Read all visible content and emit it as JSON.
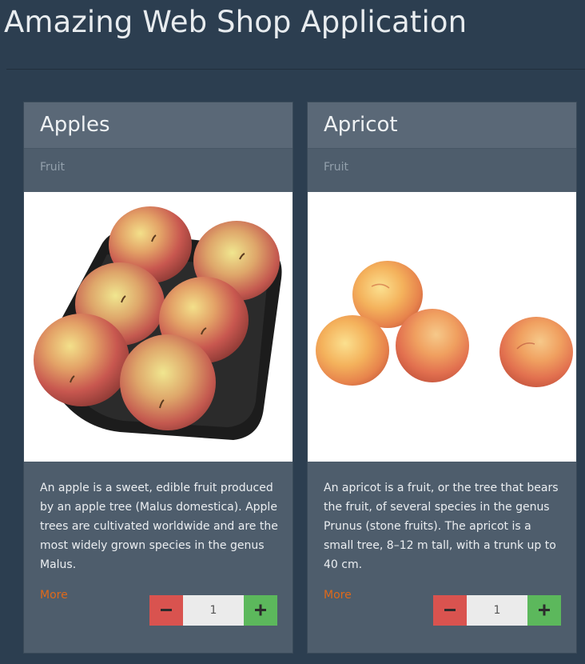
{
  "app": {
    "title": "Amazing Web Shop Application"
  },
  "products": [
    {
      "name": "Apples",
      "category": "Fruit",
      "description": "An apple is a sweet, edible fruit produced by an apple tree (Malus domestica). Apple trees are cultivated worldwide and are the most widely grown species in the genus Malus.",
      "more_label": "More",
      "quantity": "1",
      "decrement_icon": "minus-icon",
      "increment_icon": "plus-icon"
    },
    {
      "name": "Apricot",
      "category": "Fruit",
      "description": "An apricot is a fruit, or the tree that bears the fruit, of several species in the genus Prunus (stone fruits). The apricot is a small tree, 8–12 m tall, with a trunk up to 40 cm.",
      "more_label": "More",
      "quantity": "1",
      "decrement_icon": "minus-icon",
      "increment_icon": "plus-icon"
    }
  ],
  "colors": {
    "page_background": "#2c3e50",
    "card_background": "#4e5d6c",
    "link": "#df691a",
    "decrement_button": "#d9534f",
    "increment_button": "#5cb85c"
  }
}
